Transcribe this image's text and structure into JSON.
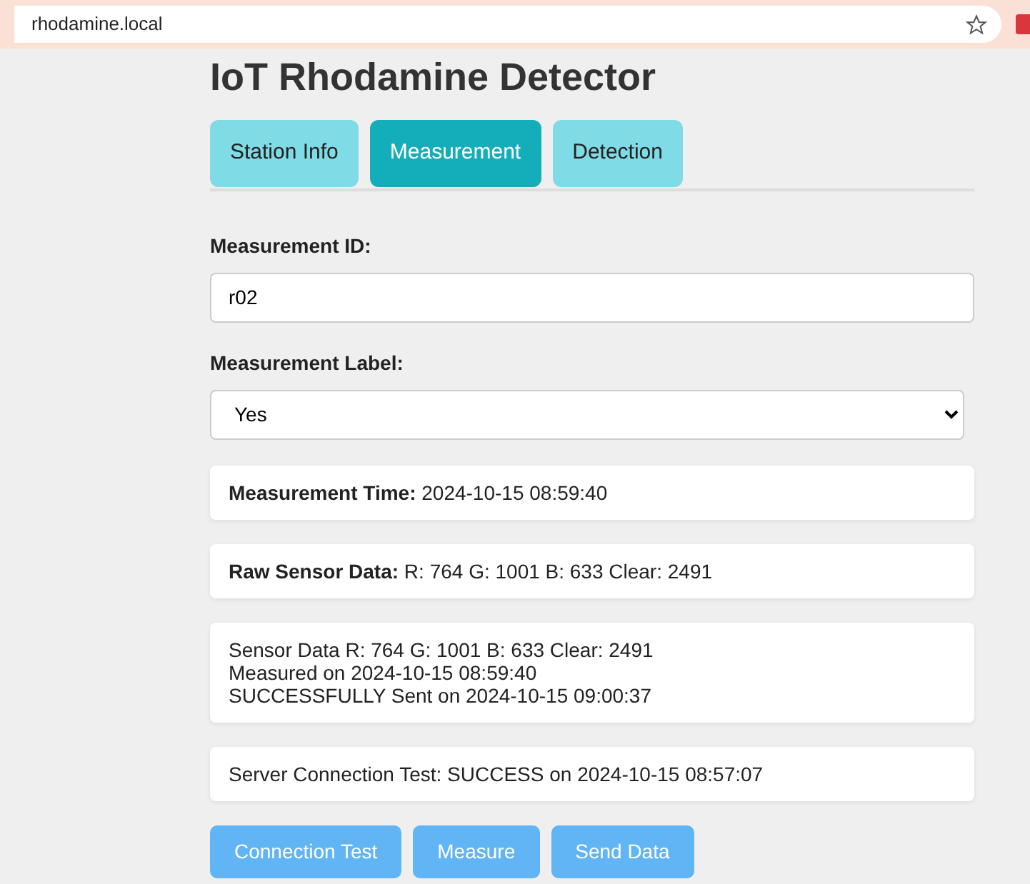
{
  "browser": {
    "address": "rhodamine.local"
  },
  "title": "IoT Rhodamine Detector",
  "tabs": [
    {
      "label": "Station Info",
      "selected": false
    },
    {
      "label": "Measurement",
      "selected": true
    },
    {
      "label": "Detection",
      "selected": false
    }
  ],
  "fields": [
    {
      "kind": "input",
      "label": "Measurement ID:",
      "value": "r02"
    },
    {
      "kind": "select",
      "label": "Measurement Label:",
      "value": "Yes"
    }
  ],
  "cards": [
    {
      "lines": [
        "**Measurement Time:** 2024-10-15 08:59:40"
      ]
    },
    {
      "lines": [
        "**Raw Sensor Data:** R: 764 G: 1001 B: 633 Clear: 2491"
      ]
    },
    {
      "lines": [
        "Sensor Data R: 764 G: 1001 B: 633 Clear: 2491",
        "Measured on 2024-10-15 08:59:40",
        "SUCCESSFULLY Sent on 2024-10-15 09:00:37"
      ]
    },
    {
      "lines": [
        "Server Connection Test: SUCCESS on 2024-10-15 08:57:07"
      ]
    }
  ],
  "buttons": [
    "Connection Test",
    "Measure",
    "Send Data"
  ]
}
